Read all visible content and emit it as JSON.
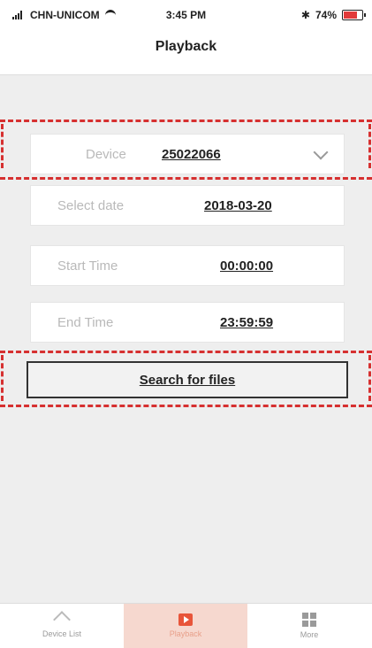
{
  "status_bar": {
    "carrier": "CHN-UNICOM",
    "time": "3:45 PM",
    "battery": "74%",
    "battery_level": 0.74
  },
  "nav": {
    "title": "Playback"
  },
  "form": {
    "device_label": "Device",
    "device_value": "25022066",
    "date_label": "Select date",
    "date_value": "2018-03-20",
    "start_label": "Start Time",
    "start_value": "00:00:00",
    "end_label": "End Time",
    "end_value": "23:59:59",
    "search_label": "Search for files"
  },
  "tabs": [
    {
      "label": "Device List",
      "icon": "home-icon"
    },
    {
      "label": "Playback",
      "icon": "playback-icon"
    },
    {
      "label": "More",
      "icon": "grid-icon"
    }
  ],
  "colors": {
    "accent": "#e8553a",
    "highlight": "#d63030",
    "active_tab_bg": "#f6d8cf"
  }
}
